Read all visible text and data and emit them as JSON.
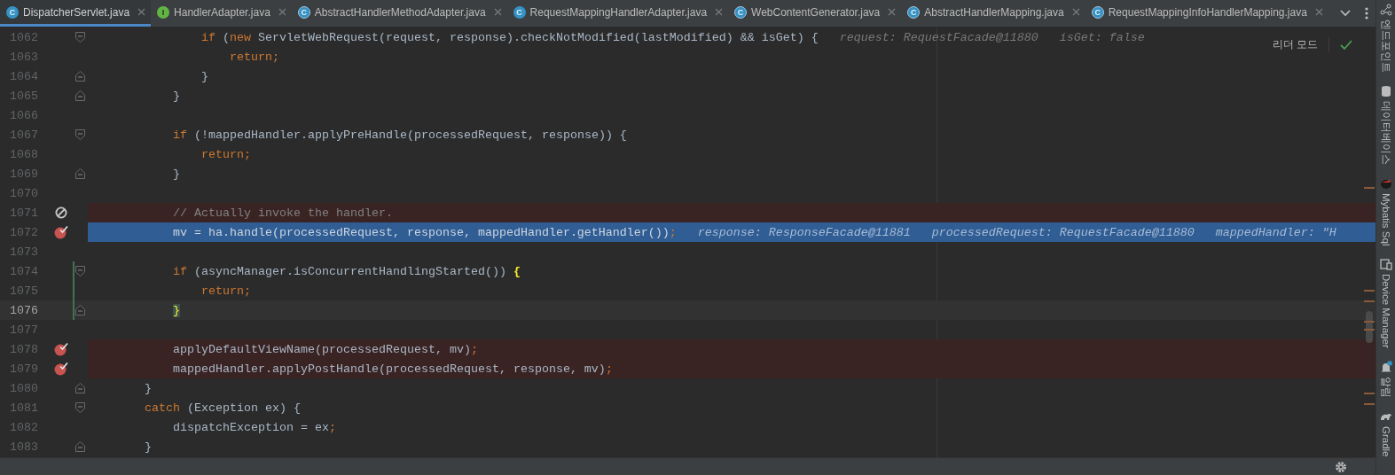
{
  "tabs": [
    {
      "label": "DispatcherServlet.java",
      "badge": "C",
      "kind": "class",
      "selected": true
    },
    {
      "label": "HandlerAdapter.java",
      "badge": "I",
      "kind": "interface",
      "selected": false
    },
    {
      "label": "AbstractHandlerMethodAdapter.java",
      "badge": "C",
      "kind": "abstract",
      "selected": false
    },
    {
      "label": "RequestMappingHandlerAdapter.java",
      "badge": "C",
      "kind": "class",
      "selected": false
    },
    {
      "label": "WebContentGenerator.java",
      "badge": "C",
      "kind": "abstract",
      "selected": false
    },
    {
      "label": "AbstractHandlerMapping.java",
      "badge": "C",
      "kind": "abstract",
      "selected": false
    },
    {
      "label": "RequestMappingInfoHandlerMapping.java",
      "badge": "C",
      "kind": "abstract",
      "selected": false
    }
  ],
  "reader_mode": "리더 모드",
  "lines": [
    {
      "number": "1062",
      "current": false,
      "caret": false,
      "fold_start": true,
      "fold_end": false,
      "modified": false,
      "tokens": [
        {
          "kind": "keyword",
          "text": "                if"
        },
        {
          "kind": "plain",
          "text": " ("
        },
        {
          "kind": "keyword",
          "text": "new"
        },
        {
          "kind": "plain",
          "text": " ServletWebRequest(request, response).checkNotModified(lastModified) && isGet) {"
        }
      ],
      "inline_values": [
        "request: RequestFacade@11880",
        "isGet: false"
      ]
    },
    {
      "number": "1063",
      "current": false,
      "caret": false,
      "fold_start": false,
      "fold_end": false,
      "modified": false,
      "tokens": [
        {
          "kind": "keyword",
          "text": "                    return;"
        }
      ]
    },
    {
      "number": "1064",
      "current": false,
      "caret": false,
      "fold_start": false,
      "fold_end": true,
      "modified": false,
      "tokens": [
        {
          "kind": "plain",
          "text": "                }"
        }
      ]
    },
    {
      "number": "1065",
      "current": false,
      "caret": false,
      "fold_start": false,
      "fold_end": true,
      "modified": false,
      "tokens": [
        {
          "kind": "plain",
          "text": "            }"
        }
      ]
    },
    {
      "number": "1066",
      "current": false,
      "caret": false,
      "fold_start": false,
      "fold_end": false,
      "modified": false
    },
    {
      "number": "1067",
      "current": false,
      "caret": false,
      "fold_start": true,
      "fold_end": false,
      "modified": false,
      "tokens": [
        {
          "kind": "keyword",
          "text": "            if"
        },
        {
          "kind": "plain",
          "text": " (!mappedHandler.applyPreHandle(processedRequest, response)) {"
        }
      ]
    },
    {
      "number": "1068",
      "current": false,
      "caret": false,
      "fold_start": false,
      "fold_end": false,
      "modified": false,
      "tokens": [
        {
          "kind": "keyword",
          "text": "                return;"
        }
      ]
    },
    {
      "number": "1069",
      "current": false,
      "caret": false,
      "fold_start": false,
      "fold_end": true,
      "modified": false,
      "tokens": [
        {
          "kind": "plain",
          "text": "            }"
        }
      ]
    },
    {
      "number": "1070",
      "current": false,
      "caret": false,
      "fold_start": false,
      "fold_end": false,
      "modified": false
    },
    {
      "number": "1071",
      "breakpoint": {
        "muted": true
      },
      "current": false,
      "caret": false,
      "fold_start": false,
      "fold_end": false,
      "modified": false,
      "tokens": [
        {
          "kind": "comment",
          "text": "            // Actually invoke the handler."
        }
      ]
    },
    {
      "number": "1072",
      "breakpoint": {
        "muted": false
      },
      "current": true,
      "caret": false,
      "fold_start": false,
      "fold_end": false,
      "modified": false,
      "tokens": [
        {
          "kind": "plain",
          "text": "            mv = ha.handle(processedRequest, response, mappedHandler.getHandler())"
        },
        {
          "kind": "keyword",
          "text": ";"
        }
      ],
      "inline_values": [
        "response: ResponseFacade@11881",
        "processedRequest: RequestFacade@11880",
        "mappedHandler: \"H"
      ]
    },
    {
      "number": "1073",
      "current": false,
      "caret": false,
      "fold_start": false,
      "fold_end": false,
      "modified": false
    },
    {
      "number": "1074",
      "current": false,
      "caret": false,
      "fold_start": true,
      "fold_end": false,
      "modified": true,
      "tokens": [
        {
          "kind": "keyword",
          "text": "            if"
        },
        {
          "kind": "plain",
          "text": " (asyncManager.isConcurrentHandlingStarted()) "
        },
        {
          "kind": "brace",
          "text": "{"
        }
      ]
    },
    {
      "number": "1075",
      "current": false,
      "caret": false,
      "fold_start": false,
      "fold_end": false,
      "modified": true,
      "tokens": [
        {
          "kind": "keyword",
          "text": "                return;"
        }
      ]
    },
    {
      "number": "1076",
      "current": false,
      "caret": true,
      "fold_start": false,
      "fold_end": true,
      "modified": true,
      "tokens": [
        {
          "kind": "brace-match",
          "text": "            }"
        }
      ]
    },
    {
      "number": "1077",
      "current": false,
      "caret": false,
      "fold_start": false,
      "fold_end": false,
      "modified": false
    },
    {
      "number": "1078",
      "breakpoint": {
        "muted": false
      },
      "current": false,
      "caret": false,
      "fold_start": false,
      "fold_end": false,
      "modified": false,
      "tokens": [
        {
          "kind": "plain",
          "text": "            applyDefaultViewName(processedRequest, mv)"
        },
        {
          "kind": "keyword",
          "text": ";"
        }
      ]
    },
    {
      "number": "1079",
      "breakpoint": {
        "muted": false
      },
      "current": false,
      "caret": false,
      "fold_start": false,
      "fold_end": false,
      "modified": false,
      "tokens": [
        {
          "kind": "plain",
          "text": "            mappedHandler.applyPostHandle(processedRequest, response, mv)"
        },
        {
          "kind": "keyword",
          "text": ";"
        }
      ]
    },
    {
      "number": "1080",
      "current": false,
      "caret": false,
      "fold_start": false,
      "fold_end": true,
      "modified": false,
      "tokens": [
        {
          "kind": "plain",
          "text": "        }"
        }
      ]
    },
    {
      "number": "1081",
      "current": false,
      "caret": false,
      "fold_start": true,
      "fold_end": false,
      "modified": false,
      "tokens": [
        {
          "kind": "keyword",
          "text": "        catch"
        },
        {
          "kind": "plain",
          "text": " (Exception ex) {"
        }
      ]
    },
    {
      "number": "1082",
      "current": false,
      "caret": false,
      "fold_start": false,
      "fold_end": false,
      "modified": false,
      "tokens": [
        {
          "kind": "plain",
          "text": "            dispatchException = ex"
        },
        {
          "kind": "keyword",
          "text": ";"
        }
      ]
    },
    {
      "number": "1083",
      "current": false,
      "caret": false,
      "fold_start": false,
      "fold_end": true,
      "modified": false,
      "tokens": [
        {
          "kind": "plain",
          "text": "        }"
        }
      ]
    }
  ],
  "tool_windows": [
    {
      "label": "엔드포인트",
      "kind": "endpoints"
    },
    {
      "label": "데이터베이스",
      "kind": "database"
    },
    {
      "label": "Mybatis Sql",
      "kind": "mybatis"
    },
    {
      "label": "Device Manager",
      "kind": "device"
    },
    {
      "label": "알림",
      "kind": "notifications"
    },
    {
      "label": "Gradle",
      "kind": "gradle"
    }
  ]
}
